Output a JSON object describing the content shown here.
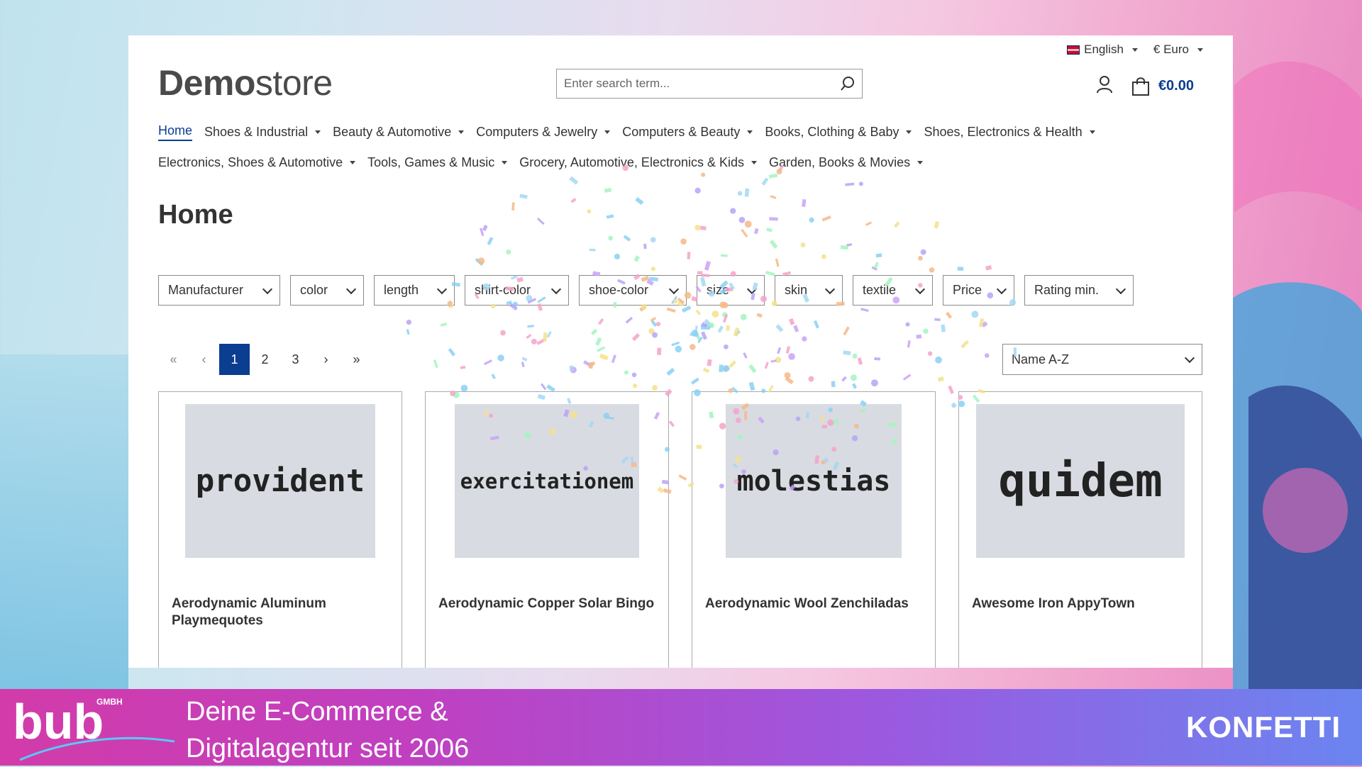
{
  "top_links": {
    "language": "English",
    "currency": "€ Euro"
  },
  "logo": {
    "bold": "Demo",
    "light": "store"
  },
  "search": {
    "placeholder": "Enter search term..."
  },
  "cart": {
    "total": "€0.00"
  },
  "nav": {
    "row1": [
      "Home",
      "Shoes & Industrial",
      "Beauty & Automotive",
      "Computers & Jewelry",
      "Computers & Beauty",
      "Books, Clothing & Baby",
      "Shoes, Electronics & Health"
    ],
    "row2": [
      "Electronics, Shoes & Automotive",
      "Tools, Games & Music",
      "Grocery, Automotive, Electronics & Kids",
      "Garden, Books & Movies"
    ]
  },
  "page_title": "Home",
  "filters": [
    "Manufacturer",
    "color",
    "length",
    "shirt-color",
    "shoe-color",
    "size",
    "skin",
    "textile",
    "Price",
    "Rating min."
  ],
  "pagination": {
    "first": "«",
    "prev": "‹",
    "pages": [
      "1",
      "2",
      "3"
    ],
    "next": "›",
    "last": "»",
    "active": "1"
  },
  "sort": {
    "selected": "Name A-Z"
  },
  "products": [
    {
      "image_text": "provident",
      "name": "Aerodynamic Aluminum Playmequotes"
    },
    {
      "image_text": "exercitationem",
      "name": "Aerodynamic Copper Solar Bingo"
    },
    {
      "image_text": "molestias",
      "name": "Aerodynamic Wool Zenchiladas"
    },
    {
      "image_text": "quidem",
      "name": "Awesome Iron AppyTown"
    }
  ],
  "banner": {
    "logo_text": "bub",
    "logo_sub": "GMBH",
    "line1": "Deine E-Commerce &",
    "line2": "Digitalagentur seit 2006",
    "right": "KONFETTI"
  },
  "colors": {
    "primary": "#0b3d91",
    "banner_start": "#d23ba9",
    "banner_end": "#6b85f0"
  }
}
